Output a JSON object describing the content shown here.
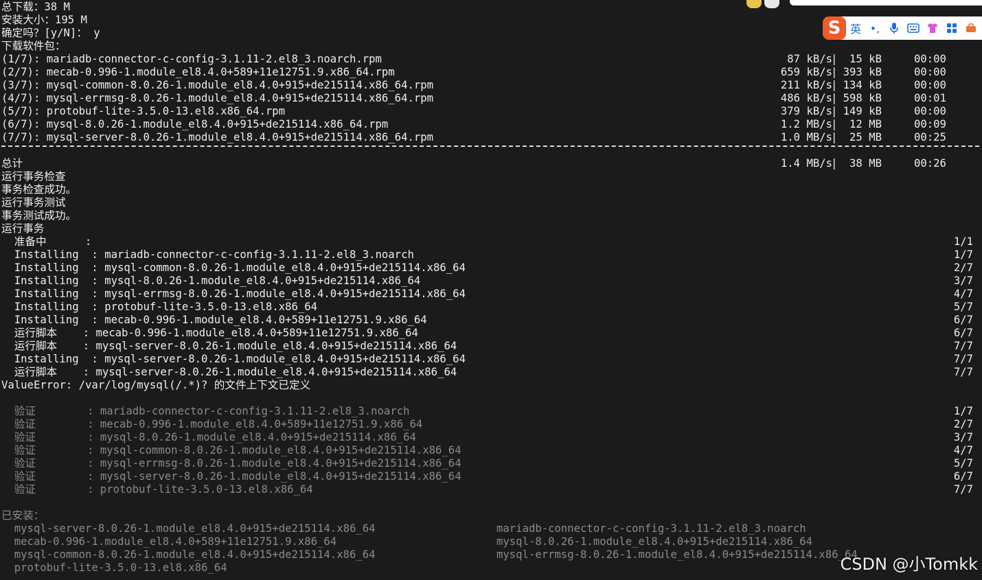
{
  "header_lines": [
    "总下载：38 M",
    "安装大小：195 M",
    "确定吗？[y/N]： y",
    "下载软件包："
  ],
  "downloads": [
    {
      "name": "(1/7): mariadb-connector-c-config-3.1.11-2.el8_3.noarch.rpm",
      "speed": "87 kB/s",
      "sep": "|",
      "size": "15 kB",
      "time": "00:00"
    },
    {
      "name": "(2/7): mecab-0.996-1.module_el8.4.0+589+11e12751.9.x86_64.rpm",
      "speed": "659 kB/s",
      "sep": "|",
      "size": "393 kB",
      "time": "00:00"
    },
    {
      "name": "(3/7): mysql-common-8.0.26-1.module_el8.4.0+915+de215114.x86_64.rpm",
      "speed": "211 kB/s",
      "sep": "|",
      "size": "134 kB",
      "time": "00:00"
    },
    {
      "name": "(4/7): mysql-errmsg-8.0.26-1.module_el8.4.0+915+de215114.x86_64.rpm",
      "speed": "486 kB/s",
      "sep": "|",
      "size": "598 kB",
      "time": "00:01"
    },
    {
      "name": "(5/7): protobuf-lite-3.5.0-13.el8.x86_64.rpm",
      "speed": "379 kB/s",
      "sep": "|",
      "size": "149 kB",
      "time": "00:00"
    },
    {
      "name": "(6/7): mysql-8.0.26-1.module_el8.4.0+915+de215114.x86_64.rpm",
      "speed": "1.2 MB/s",
      "sep": "|",
      "size": "12 MB",
      "time": "00:09"
    },
    {
      "name": "(7/7): mysql-server-8.0.26-1.module_el8.4.0+915+de215114.x86_64.rpm",
      "speed": "1.0 MB/s",
      "sep": "|",
      "size": "25 MB",
      "time": "00:25"
    }
  ],
  "total": {
    "label": "总计",
    "speed": "1.4 MB/s",
    "sep": "|",
    "size": "38 MB",
    "time": "00:26"
  },
  "transaction_lines": [
    "运行事务检查",
    "事务检查成功。",
    "运行事务测试",
    "事务测试成功。",
    "运行事务"
  ],
  "install_steps": [
    {
      "text": "  准备中      :",
      "progress": "1/1"
    },
    {
      "text": "  Installing  : mariadb-connector-c-config-3.1.11-2.el8_3.noarch",
      "progress": "1/7"
    },
    {
      "text": "  Installing  : mysql-common-8.0.26-1.module_el8.4.0+915+de215114.x86_64",
      "progress": "2/7"
    },
    {
      "text": "  Installing  : mysql-8.0.26-1.module_el8.4.0+915+de215114.x86_64",
      "progress": "3/7"
    },
    {
      "text": "  Installing  : mysql-errmsg-8.0.26-1.module_el8.4.0+915+de215114.x86_64",
      "progress": "4/7"
    },
    {
      "text": "  Installing  : protobuf-lite-3.5.0-13.el8.x86_64",
      "progress": "5/7"
    },
    {
      "text": "  Installing  : mecab-0.996-1.module_el8.4.0+589+11e12751.9.x86_64",
      "progress": "6/7"
    },
    {
      "text": "  运行脚本    : mecab-0.996-1.module_el8.4.0+589+11e12751.9.x86_64",
      "progress": "6/7"
    },
    {
      "text": "  运行脚本    : mysql-server-8.0.26-1.module_el8.4.0+915+de215114.x86_64",
      "progress": "7/7"
    },
    {
      "text": "  Installing  : mysql-server-8.0.26-1.module_el8.4.0+915+de215114.x86_64",
      "progress": "7/7"
    },
    {
      "text": "  运行脚本    : mysql-server-8.0.26-1.module_el8.4.0+915+de215114.x86_64",
      "progress": "7/7"
    }
  ],
  "error_line": "ValueError: /var/log/mysql(/.*)? 的文件上下文已定义",
  "verify_steps": [
    {
      "text": "  验证        : mariadb-connector-c-config-3.1.11-2.el8_3.noarch",
      "progress": "1/7"
    },
    {
      "text": "  验证        : mecab-0.996-1.module_el8.4.0+589+11e12751.9.x86_64",
      "progress": "2/7"
    },
    {
      "text": "  验证        : mysql-8.0.26-1.module_el8.4.0+915+de215114.x86_64",
      "progress": "3/7"
    },
    {
      "text": "  验证        : mysql-common-8.0.26-1.module_el8.4.0+915+de215114.x86_64",
      "progress": "4/7"
    },
    {
      "text": "  验证        : mysql-errmsg-8.0.26-1.module_el8.4.0+915+de215114.x86_64",
      "progress": "5/7"
    },
    {
      "text": "  验证        : mysql-server-8.0.26-1.module_el8.4.0+915+de215114.x86_64",
      "progress": "6/7"
    },
    {
      "text": "  验证        : protobuf-lite-3.5.0-13.el8.x86_64",
      "progress": "7/7"
    }
  ],
  "installed_label": "已安装：",
  "installed_left": [
    "  mysql-server-8.0.26-1.module_el8.4.0+915+de215114.x86_64",
    "  mecab-0.996-1.module_el8.4.0+589+11e12751.9.x86_64",
    "  mysql-common-8.0.26-1.module_el8.4.0+915+de215114.x86_64",
    "  protobuf-lite-3.5.0-13.el8.x86_64"
  ],
  "installed_right": [
    "mariadb-connector-c-config-3.1.11-2.el8_3.noarch",
    "mysql-8.0.26-1.module_el8.4.0+915+de215114.x86_64",
    "mysql-errmsg-8.0.26-1.module_el8.4.0+915+de215114.x86_64"
  ],
  "ime": {
    "logo": "S",
    "lang": "英",
    "punct": "•,",
    "icons": [
      "mic-icon",
      "keyboard-icon",
      "skin-icon",
      "apps-icon",
      "toolbox-icon"
    ]
  },
  "watermark": "CSDN @小Tomkk",
  "colors": {
    "background": "#1b1b1b",
    "text": "#eeeeee",
    "dim_text": "#8a8a8a",
    "ime_accent": "#1e6fe0",
    "ime_logo": "#f25a2a"
  }
}
